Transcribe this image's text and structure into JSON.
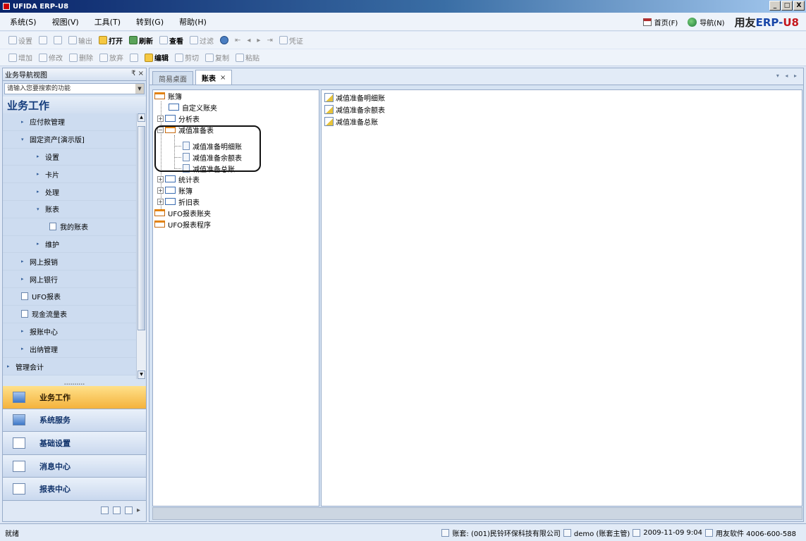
{
  "window": {
    "title": "UFIDA ERP-U8",
    "minimize": "_",
    "maximize": "□",
    "close": "X"
  },
  "menu": {
    "items": [
      "系统(S)",
      "视图(V)",
      "工具(T)",
      "转到(G)",
      "帮助(H)"
    ],
    "home": "首页(F)",
    "navigate": "导航(N)",
    "brand_main": "用友",
    "brand_erp": "ERP-",
    "brand_u8": "U8"
  },
  "toolbar1": {
    "items": [
      "设置",
      "",
      "",
      "输出",
      "打开",
      "刷新",
      "查看",
      "过滤",
      "",
      "",
      "",
      "",
      "",
      "凭证"
    ]
  },
  "toolbar2": {
    "items": [
      "增加",
      "修改",
      "删除",
      "放弃",
      "",
      "编辑",
      "剪切",
      "复制",
      "粘贴"
    ]
  },
  "nav": {
    "header": "业务导航视图",
    "pin": "₹ ×",
    "search_placeholder": "请输入您要搜索的功能",
    "section_title": "业务工作",
    "items": [
      {
        "label": "应付款管理",
        "level": "lvl1",
        "arrow": "▸"
      },
      {
        "label": "固定资产[演示版]",
        "level": "lvl1",
        "arrow": "▾"
      },
      {
        "label": "设置",
        "level": "lvl2",
        "arrow": "▸"
      },
      {
        "label": "卡片",
        "level": "lvl2",
        "arrow": "▸"
      },
      {
        "label": "处理",
        "level": "lvl2",
        "arrow": "▸"
      },
      {
        "label": "账表",
        "level": "lvl2",
        "arrow": "▾"
      },
      {
        "label": "我的账表",
        "level": "lvl3",
        "arrow": ""
      },
      {
        "label": "维护",
        "level": "lvl2",
        "arrow": "▸"
      },
      {
        "label": "网上报销",
        "level": "lvl1",
        "arrow": "▸"
      },
      {
        "label": "网上银行",
        "level": "lvl1",
        "arrow": "▸"
      },
      {
        "label": "UFO报表",
        "level": "lvl1",
        "arrow": ""
      },
      {
        "label": "现金流量表",
        "level": "lvl1",
        "arrow": ""
      },
      {
        "label": "报账中心",
        "level": "lvl1",
        "arrow": "▸"
      },
      {
        "label": "出纳管理",
        "level": "lvl1",
        "arrow": "▸"
      },
      {
        "label": "管理会计",
        "level": "lvl0",
        "arrow": "▸"
      }
    ],
    "buttons": [
      "业务工作",
      "系统服务",
      "基础设置",
      "消息中心",
      "报表中心"
    ]
  },
  "tabs": [
    {
      "label": "简易桌面",
      "active": false
    },
    {
      "label": "账表",
      "active": true,
      "close": "×"
    }
  ],
  "tab_nav": "▾ ◂ ▸",
  "tree": {
    "root": "账簿",
    "custom": "自定义账夹",
    "analysis": "分析表",
    "impairment": "减值准备表",
    "impairment_children": [
      "减值准备明细账",
      "减值准备余额表",
      "减值准备总账"
    ],
    "stats": "统计表",
    "ledger": "账簿",
    "depreciation": "折旧表",
    "ufo_folder": "UFO报表账夹",
    "ufo_program": "UFO报表程序"
  },
  "right_list": [
    "减值准备明细账",
    "减值准备余额表",
    "减值准备总账"
  ],
  "status": {
    "ready": "就绪",
    "account": "账套: (001)民铃环保科技有限公司",
    "user": "demo (账套主管)",
    "datetime": "2009-11-09 9:04",
    "company": "用友软件 4006-600-588"
  }
}
